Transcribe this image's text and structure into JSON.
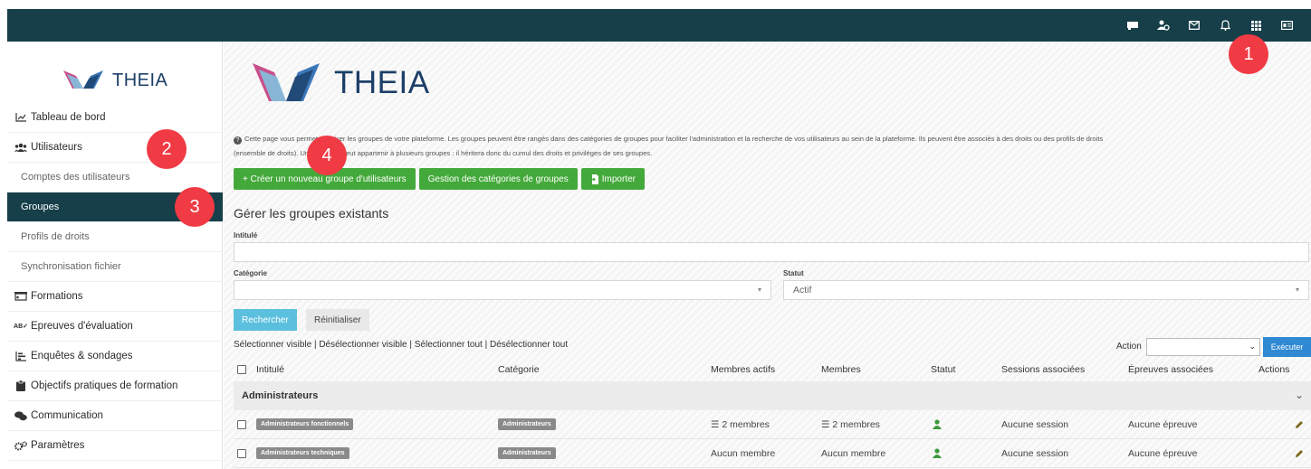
{
  "brand": {
    "name": "THEIA"
  },
  "topbar": {
    "icons": [
      "flag-icon",
      "users-icon",
      "mail-icon",
      "bell-icon",
      "grid-icon",
      "id-card-icon"
    ]
  },
  "badges": [
    "1",
    "2",
    "3",
    "4"
  ],
  "sidebar": {
    "items": [
      {
        "label": "Tableau de bord",
        "icon": "chart-line-icon"
      },
      {
        "label": "Utilisateurs",
        "icon": "users-icon"
      },
      {
        "label": "Comptes des utilisateurs"
      },
      {
        "label": "Groupes"
      },
      {
        "label": "Profils de droits"
      },
      {
        "label": "Synchronisation fichier"
      },
      {
        "label": "Formations",
        "icon": "presentation-icon"
      },
      {
        "label": "Epreuves d'évaluation",
        "icon": "spellcheck-icon"
      },
      {
        "label": "Enquêtes & sondages",
        "icon": "poll-icon"
      },
      {
        "label": "Objectifs pratiques de formation",
        "icon": "clipboard-icon"
      },
      {
        "label": "Communication",
        "icon": "comments-icon"
      },
      {
        "label": "Paramètres",
        "icon": "gears-icon"
      }
    ]
  },
  "main": {
    "intro_line1": "Cette page vous permet de gérer les groupes de votre plateforme. Les groupes peuvent être rangés dans des catégories de groupes pour faciliter l'administration et la recherche de vos utilisateurs au sein de la plateforme. Ils peuvent être associés à des droits ou des profils de droits",
    "intro_line2": "(ensemble de droits). Un utilisateur peut appartenir à plusieurs groupes : il héritera donc du cumul des droits et privilèges de ses groupes.",
    "buttons": {
      "create": "+ Créer un nouveau groupe d'utilisateurs",
      "categories": "Gestion des catégories de groupes",
      "import": "Importer"
    },
    "section_title": "Gérer les groupes existants",
    "filters": {
      "intitule_label": "Intitulé",
      "intitule_value": "",
      "categorie_label": "Catégorie",
      "categorie_value": "",
      "statut_label": "Statut",
      "statut_value": "Actif",
      "search": "Rechercher",
      "reset": "Réinitialiser"
    },
    "selection": {
      "select_visible": "Sélectionner visible",
      "deselect_visible": "Désélectionner visible",
      "select_all": "Sélectionner tout",
      "deselect_all": "Désélectionner tout",
      "sep": " | "
    },
    "action": {
      "label": "Action",
      "value": "",
      "execute": "Exécuter"
    },
    "table": {
      "headers": {
        "intitule": "Intitulé",
        "categorie": "Catégorie",
        "membres_actifs": "Membres actifs",
        "membres": "Membres",
        "statut": "Statut",
        "sessions": "Sessions associées",
        "epreuves": "Épreuves associées",
        "actions": "Actions"
      },
      "group": "Administrateurs",
      "rows": [
        {
          "name": "Administrateurs fonctionnels",
          "category": "Administrateurs",
          "active_members": "2 membres",
          "members": "2 membres",
          "status": "active",
          "sessions": "Aucune session",
          "epreuves": "Aucune épreuve"
        },
        {
          "name": "Administrateurs techniques",
          "category": "Administrateurs",
          "active_members": "Aucun membre",
          "members": "Aucun membre",
          "status": "active",
          "sessions": "Aucune session",
          "epreuves": "Aucune épreuve"
        }
      ]
    }
  },
  "colors": {
    "topbar": "#163f49",
    "active_menu": "#163f49",
    "primary_green": "#44a93b",
    "search_blue": "#5bc0de",
    "execute_blue": "#2f89d3",
    "badge_red": "#f03a44",
    "brand_navy": "#1c3f68"
  }
}
